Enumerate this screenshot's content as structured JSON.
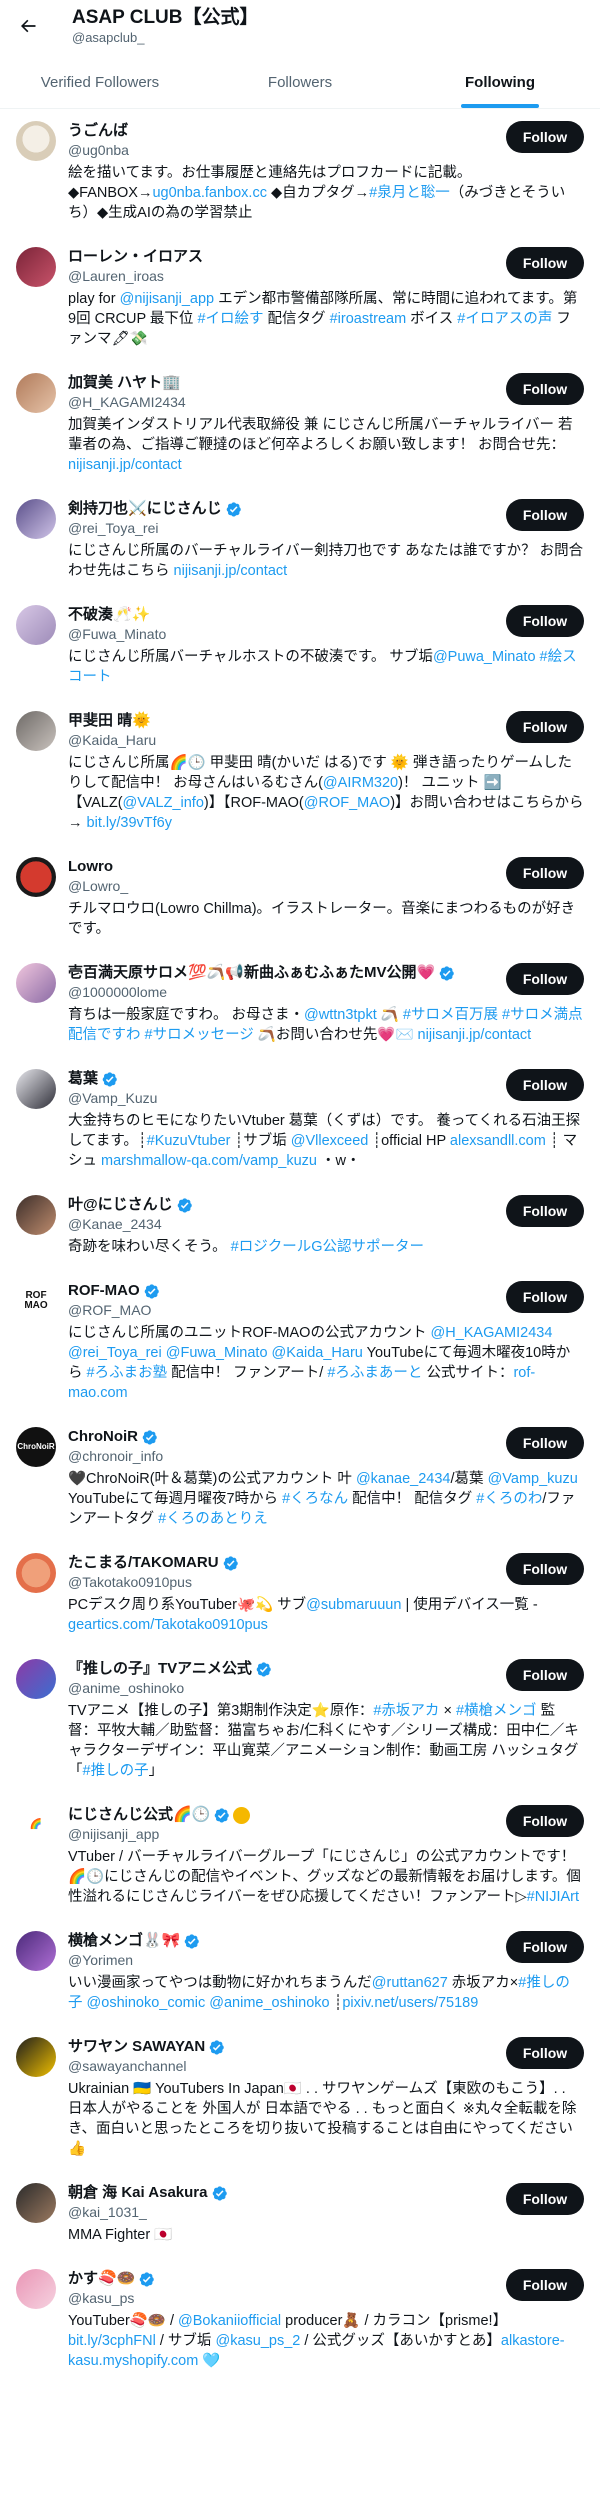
{
  "header": {
    "title": "ASAP CLUB【公式】",
    "handle": "@asapclub_"
  },
  "tabs": [
    {
      "label": "Verified Followers"
    },
    {
      "label": "Followers"
    },
    {
      "label": "Following"
    }
  ],
  "follow_label": "Follow",
  "colors": {
    "accent": "#1d9bf0",
    "text": "#0f1419",
    "muted": "#536471",
    "button": "#0f1419"
  },
  "users": [
    {
      "name": "うごんば",
      "handle": "@ug0nba",
      "verified": false,
      "bio": [
        "絵を描いてます。お仕事履歴と連絡先はプロフカードに記載。◆FANBOX→",
        {
          "l": "ug0nba.fanbox.cc"
        },
        " ◆自カプタグ→",
        {
          "l": "#泉月と聡一"
        },
        "（みづきとそういち）◆生成AIの為の学習禁止"
      ]
    },
    {
      "name": "ローレン・イロアス",
      "handle": "@Lauren_iroas",
      "verified": false,
      "bio": [
        "play for ",
        {
          "l": "@nijisanji_app"
        },
        " エデン都市警備部隊所属、常に時間に追われてます。第9回 CRCUP 最下位 ",
        {
          "l": "#イロ絵す"
        },
        " 配信タグ ",
        {
          "l": "#iroastream"
        },
        " ボイス ",
        {
          "l": "#イロアスの声"
        },
        " ファンマ🖋💸"
      ]
    },
    {
      "name": "加賀美 ハヤト🏢",
      "handle": "@H_KAGAMI2434",
      "verified": false,
      "bio": [
        "加賀美インダストリアル代表取締役 兼 にじさんじ所属バーチャルライバー 若輩者の為、ご指導ご鞭撻のほど何卒よろしくお願い致します！ お問合せ先：",
        {
          "l": "nijisanji.jp/contact"
        }
      ]
    },
    {
      "name": "剣持刀也⚔️にじさんじ",
      "handle": "@rei_Toya_rei",
      "verified": true,
      "bio": [
        "にじさんじ所属のバーチャルライバー剣持刀也です あなたは誰ですか？ お問合わせ先はこちら ",
        {
          "l": "nijisanji.jp/contact"
        }
      ]
    },
    {
      "name": "不破湊🥂✨",
      "handle": "@Fuwa_Minato",
      "verified": false,
      "bio": [
        "にじさんじ所属バーチャルホストの不破湊です。 サブ垢",
        {
          "l": "@Puwa_Minato"
        },
        " ",
        {
          "l": "#絵スコート"
        }
      ]
    },
    {
      "name": "甲斐田 晴🌞",
      "handle": "@Kaida_Haru",
      "verified": false,
      "bio": [
        "にじさんじ所属🌈🕒 甲斐田 晴(かいだ はる)です 🌞 弾き語ったりゲームしたりして配信中！ お母さんはいるむさん(",
        {
          "l": "@AIRM320"
        },
        ")！ ユニット ➡️ 【VALZ(",
        {
          "l": "@VALZ_info"
        },
        ")】【ROF-MAO(",
        {
          "l": "@ROF_MAO"
        },
        ")】お問い合わせはこちらから → ",
        {
          "l": "bit.ly/39vTf6y"
        }
      ]
    },
    {
      "name": "Lowro",
      "handle": "@Lowro_",
      "verified": false,
      "bio": [
        "チルマロウロ(Lowro Chillma)。イラストレーター。音楽にまつわるものが好きです。"
      ]
    },
    {
      "name": "壱百満天原サロメ💯🪃📢新曲ふぁむふぁたMV公開💗",
      "handle": "@1000000lome",
      "verified": true,
      "bio": [
        "育ちは一般家庭ですわ。 お母さま・",
        {
          "l": "@wttn3tpkt"
        },
        " 🪃 ",
        {
          "l": "#サロメ百万展"
        },
        " ",
        {
          "l": "#サロメ満点配信ですわ"
        },
        " ",
        {
          "l": "#サロメッセージ"
        },
        " 🪃お問い合わせ先💗✉️ ",
        {
          "l": "nijisanji.jp/contact"
        }
      ]
    },
    {
      "name": "葛葉",
      "handle": "@Vamp_Kuzu",
      "verified": true,
      "bio": [
        "大金持ちのヒモになりたいVtuber 葛葉（くずは）です。 養ってくれる石油王探してます。┊",
        {
          "l": "#KuzuVtuber"
        },
        " ┊サブ垢 ",
        {
          "l": "@Vllexceed"
        },
        " ┊official HP ",
        {
          "l": "alexsandll.com"
        },
        " ┊ マシュ ",
        {
          "l": "marshmallow-qa.com/vamp_kuzu"
        },
        " ・w・"
      ]
    },
    {
      "name": "叶@にじさんじ",
      "handle": "@Kanae_2434",
      "verified": true,
      "bio": [
        "奇跡を味わい尽くそう。 ",
        {
          "l": "#ロジクールG公認サポーター"
        }
      ]
    },
    {
      "name": "ROF-MAO",
      "handle": "@ROF_MAO",
      "verified": true,
      "bio": [
        "にじさんじ所属のユニットROF-MAOの公式アカウント ",
        {
          "l": "@H_KAGAMI2434"
        },
        " ",
        {
          "l": "@rei_Toya_rei"
        },
        " ",
        {
          "l": "@Fuwa_Minato"
        },
        " ",
        {
          "l": "@Kaida_Haru"
        },
        " YouTubeにて毎週木曜夜10時から ",
        {
          "l": "#ろふまお塾"
        },
        " 配信中！ ファンアート/ ",
        {
          "l": "#ろふまあーと"
        },
        " 公式サイト：",
        {
          "l": "rof-mao.com"
        }
      ]
    },
    {
      "name": "ChroNoiR",
      "handle": "@chronoir_info",
      "verified": true,
      "bio": [
        "🖤ChroNoiR(叶＆葛葉)の公式アカウント 叶 ",
        {
          "l": "@kanae_2434"
        },
        "/葛葉 ",
        {
          "l": "@Vamp_kuzu"
        },
        " YouTubeにて毎週月曜夜7時から ",
        {
          "l": "#くろなん"
        },
        " 配信中！ 配信タグ ",
        {
          "l": "#くろのわ"
        },
        "/ファンアートタグ ",
        {
          "l": "#くろのあとりえ"
        }
      ]
    },
    {
      "name": "たこまる/TAKOMARU",
      "handle": "@Takotako0910pus",
      "verified": true,
      "bio": [
        "PCデスク周り系YouTuber🐙💫 サブ",
        {
          "l": "@submaruuun"
        },
        " | 使用デバイス一覧 - ",
        {
          "l": "geartics.com/Takotako0910pus"
        }
      ]
    },
    {
      "name": "『推しの子』TVアニメ公式",
      "handle": "@anime_oshinoko",
      "verified": true,
      "bio": [
        "TVアニメ【推しの子】第3期制作決定⭐原作：",
        {
          "l": "#赤坂アカ"
        },
        " × ",
        {
          "l": "#横槍メンゴ"
        },
        " 監督：平牧大輔／助監督：猫富ちゃお/仁科くにやす／シリーズ構成：田中仁／キャラクターデザイン：平山寛菜／アニメーション制作：動画工房 ハッシュタグ「",
        {
          "l": "#推しの子"
        },
        "」"
      ]
    },
    {
      "name": "にじさんじ公式🌈🕒",
      "handle": "@nijisanji_app",
      "verified": true,
      "gold": true,
      "bio": [
        "VTuber / バーチャルライバーグループ「にじさんじ」の公式アカウントです！🌈🕒にじさんじの配信やイベント、グッズなどの最新情報をお届けします。個性溢れるにじさんじライバーをぜひ応援してください！ファンアート▷",
        {
          "l": "#NIJIArt"
        }
      ]
    },
    {
      "name": "横槍メンゴ🐰🎀",
      "handle": "@Yorimen",
      "verified": true,
      "bio": [
        "いい漫画家ってやつは動物に好かれちまうんだ",
        {
          "l": "@ruttan627"
        },
        " 赤坂アカ×",
        {
          "l": "#推しの子"
        },
        " ",
        {
          "l": "@oshinoko_comic"
        },
        " ",
        {
          "l": "@anime_oshinoko"
        },
        " ┊",
        {
          "l": "pixiv.net/users/75189"
        }
      ]
    },
    {
      "name": "サワヤン SAWAYAN",
      "handle": "@sawayanchannel",
      "verified": true,
      "bio": [
        "Ukrainian 🇺🇦 YouTubers In Japan🇯🇵 . . サワヤンゲームズ【東欧のもこう】. . 日本人がやることを 外国人が 日本語でやる . . もっと面白く ※丸々全転載を除き、面白いと思ったところを切り抜いて投稿することは自由にやってください👍"
      ]
    },
    {
      "name": "朝倉 海 Kai Asakura",
      "handle": "@kai_1031_",
      "verified": true,
      "bio": [
        "MMA Fighter 🇯🇵"
      ]
    },
    {
      "name": "かす🍣🍩",
      "handle": "@kasu_ps",
      "verified": true,
      "bio": [
        "YouTuber🍣🍩 / ",
        {
          "l": "@Bokaniiofficial"
        },
        " producer🧸 / カラコン【prisme!】 ",
        {
          "l": "bit.ly/3cphFNl"
        },
        " / サブ垢 ",
        {
          "l": "@kasu_ps_2"
        },
        " / 公式グッズ【あいかすとあ】",
        {
          "l": "alkastore-kasu.myshopify.com"
        },
        " 🩵"
      ]
    }
  ]
}
